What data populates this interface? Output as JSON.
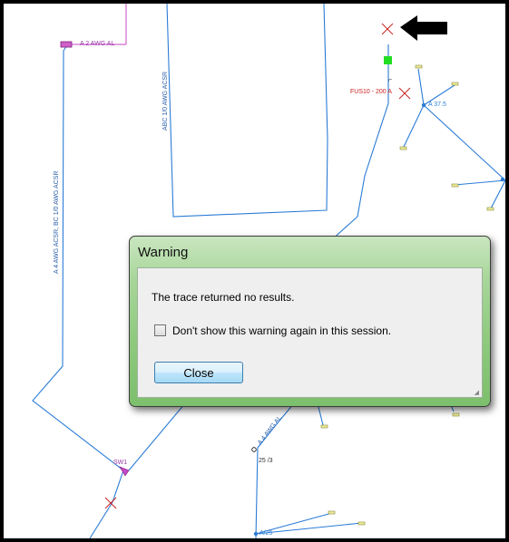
{
  "map": {
    "labels": {
      "wire_top": "A 2 AWG AL",
      "abc": "ABC 1/0 AWG ACSR",
      "left_long": "A 4 AWG ACSR, BC 1/0 AWG ACSR",
      "fuse": "FUS10 - 200 A",
      "node_right": "A 37.5",
      "sw": "SW1",
      "a4bottom": "A 4 AWG AL",
      "val25": "25 /3",
      "a25": "A/25"
    }
  },
  "dialog": {
    "title": "Warning",
    "message": "The trace returned no results.",
    "checkbox_label": "Don't show this warning again in this session.",
    "checkbox_checked": false,
    "close_label": "Close"
  }
}
